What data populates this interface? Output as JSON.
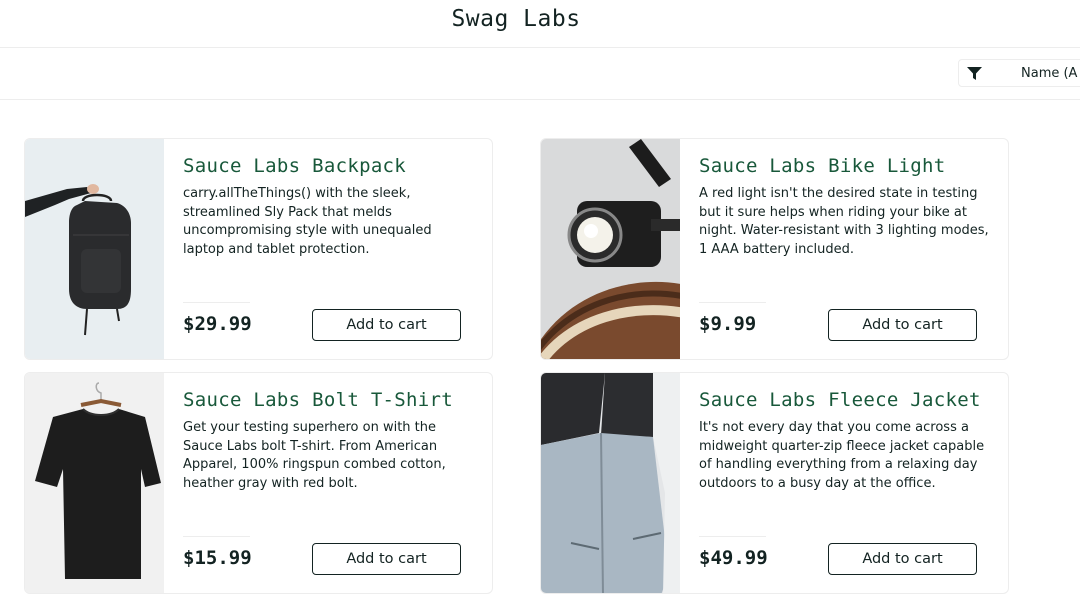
{
  "header": {
    "title": "Swag Labs"
  },
  "sort": {
    "label": "Name (A to Z)",
    "icon": "filter-icon"
  },
  "products": [
    {
      "name": "Sauce Labs Backpack",
      "description": "carry.allTheThings() with the sleek, streamlined Sly Pack that melds uncompromising style with unequaled laptop and tablet protection.",
      "price": "$29.99",
      "button": "Add to cart",
      "image": "backpack-image"
    },
    {
      "name": "Sauce Labs Bike Light",
      "description": "A red light isn't the desired state in testing but it sure helps when riding your bike at night. Water-resistant with 3 lighting modes, 1 AAA battery included.",
      "price": "$9.99",
      "button": "Add to cart",
      "image": "bike-light-image"
    },
    {
      "name": "Sauce Labs Bolt T-Shirt",
      "description": "Get your testing superhero on with the Sauce Labs bolt T-shirt. From American Apparel, 100% ringspun combed cotton, heather gray with red bolt.",
      "price": "$15.99",
      "button": "Add to cart",
      "image": "t-shirt-image"
    },
    {
      "name": "Sauce Labs Fleece Jacket",
      "description": "It's not every day that you come across a midweight quarter-zip fleece jacket capable of handling everything from a relaxing day outdoors to a busy day at the office.",
      "price": "$49.99",
      "button": "Add to cart",
      "image": "fleece-jacket-image"
    }
  ],
  "colors": {
    "accent": "#18583a",
    "text": "#132322",
    "border": "#ededed"
  }
}
